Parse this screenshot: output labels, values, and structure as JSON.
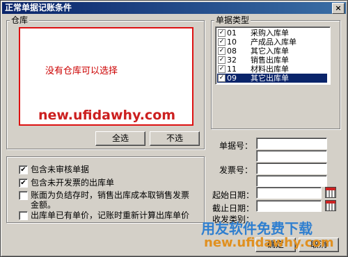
{
  "window": {
    "title": "正常单据记账条件",
    "close_glyph": "×"
  },
  "warehouse": {
    "label": "仓库",
    "empty_message": "没有仓库可以选择",
    "select_all": "全选",
    "select_none": "不选"
  },
  "watermark": {
    "url": "new.ufidawhy.com",
    "slogan": "用友软件免费下载",
    "url_bottom": "new.ufidawhy.com"
  },
  "doc_types": {
    "label": "单据类型",
    "items": [
      {
        "code": "01",
        "name": "采购入库单",
        "checked": true,
        "selected": false
      },
      {
        "code": "10",
        "name": "产成品入库单",
        "checked": true,
        "selected": false
      },
      {
        "code": "08",
        "name": "其它入库单",
        "checked": true,
        "selected": false
      },
      {
        "code": "32",
        "name": "销售出库单",
        "checked": true,
        "selected": false
      },
      {
        "code": "11",
        "name": "材料出库单",
        "checked": true,
        "selected": false
      },
      {
        "code": "09",
        "name": "其它出库单",
        "checked": true,
        "selected": true
      }
    ]
  },
  "options": [
    {
      "text": "包含未审核单据",
      "checked": true
    },
    {
      "text": "包含未开发票的出库单",
      "checked": true
    },
    {
      "text": "账面为负结存时，销售出库成本取销售发票",
      "text2": "金额。",
      "checked": false
    },
    {
      "text": "出库单已有单价，记账时重新计算出库单价",
      "checked": false
    }
  ],
  "fields": {
    "doc_no": "单据号：",
    "invoice_no": "发票号：",
    "start_date": "起始日期：",
    "end_date": "截止日期：",
    "receipt_category": "收发类别："
  },
  "buttons": {
    "ok": "确定",
    "cancel": "取消"
  },
  "check_glyph": "✔",
  "check_mark": "✓"
}
